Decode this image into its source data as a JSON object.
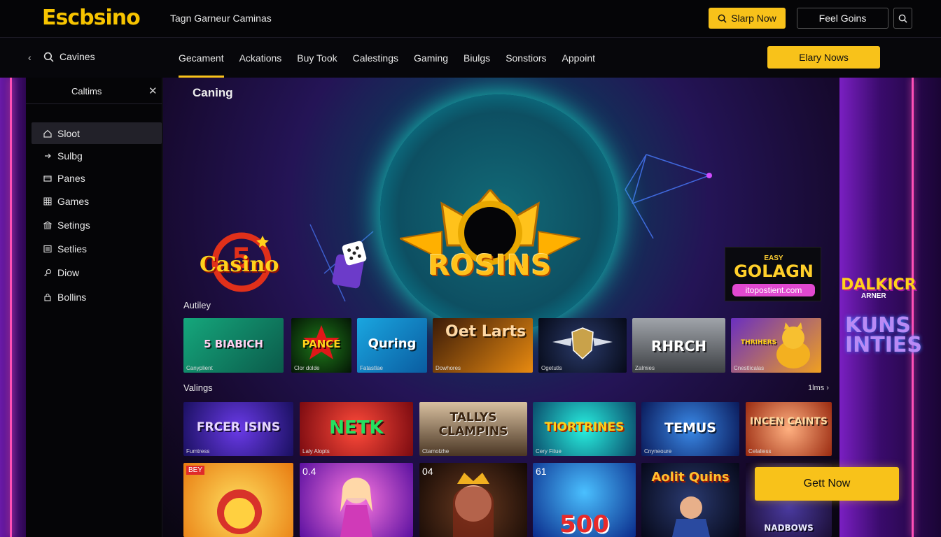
{
  "header": {
    "logo": "Escbsino",
    "tagline": "Tagn Garneur Caminas",
    "signup_label": "Slarp Now",
    "secondary_label": "Feel Goins"
  },
  "nav": {
    "search_label": "Cavines",
    "links": [
      "Gecament",
      "Ackations",
      "Buy Took",
      "Calestings",
      "Gaming",
      "Biulgs",
      "Sonstiors",
      "Appoint"
    ],
    "cta_label": "Elary Nows"
  },
  "sidebar": {
    "title": "Caltims",
    "items": [
      {
        "label": "Sloot",
        "icon": "home-icon"
      },
      {
        "label": "Sulbg",
        "icon": "arrow-icon"
      },
      {
        "label": "Panes",
        "icon": "cards-icon"
      },
      {
        "label": "Games",
        "icon": "grid-icon"
      },
      {
        "label": "Setings",
        "icon": "bank-icon"
      },
      {
        "label": "Setlies",
        "icon": "list-icon"
      },
      {
        "label": "Diow",
        "icon": "key-icon"
      },
      {
        "label": "Bollins",
        "icon": "lock-icon"
      }
    ]
  },
  "hero": {
    "title": "Caning",
    "emblem_text": "ROSINS",
    "casino_text": "Casino",
    "casino_number": "5",
    "promo": {
      "top": "EASY",
      "main": "GOLAGN",
      "bottom": "itopostient.com"
    }
  },
  "sections": {
    "activity_label": "Autiley",
    "valings_label": "Valings",
    "more_label": "1lms ›"
  },
  "row1": [
    {
      "name": "5 BIABICH",
      "cap": "Canyplient",
      "bg": "#15a77c"
    },
    {
      "name": "PANCE",
      "cap": "Clor dolde",
      "bg": "#0a3b12"
    },
    {
      "name": "Quring",
      "cap": "Fatastlae",
      "bg": "#1aa6e0"
    },
    {
      "name": "Oet Larts",
      "cap": "Dowhores",
      "bg": "#3a1a08"
    },
    {
      "name": "",
      "cap": "Ogetutls",
      "bg": "#0c1426"
    },
    {
      "name": "RHRCH",
      "cap": "Zalmies",
      "bg": "#6a6d72"
    },
    {
      "name": "THRIHERS",
      "cap": "Cnestlicalas",
      "bg": "#6a2fc0"
    }
  ],
  "row2": [
    {
      "name": "FRCER ISINS",
      "cap": "Fumtress",
      "bg": "#3a2ad0"
    },
    {
      "name": "NETK",
      "cap": "Laly Alopts",
      "bg": "#e03a3a"
    },
    {
      "name": "TALLYS CLAMPINS",
      "cap": "Ctamolzhe",
      "bg": "#a88a6a"
    },
    {
      "name": "TIORTRINES",
      "cap": "Cery Fitue",
      "bg": "#12c0c4"
    },
    {
      "name": "TEMUS",
      "cap": "Cnyneoure",
      "bg": "#1c3aa0"
    },
    {
      "name": "INCEN CAINTS",
      "cap": "Celaliess",
      "bg": "#e06a4a"
    }
  ],
  "row3": [
    {
      "name": "",
      "badge": "BEY",
      "bg": "#f0c020"
    },
    {
      "name": "",
      "badge": "0.4",
      "bg": "#b23ad0"
    },
    {
      "name": "",
      "badge": "04",
      "bg": "#2a1a12"
    },
    {
      "name": "500",
      "badge": "61",
      "bg": "#1a5ad8"
    },
    {
      "name": "Aolit Quins",
      "badge": "",
      "bg": "#0c1430"
    },
    {
      "name": "NADBOWS",
      "badge": "",
      "bg": "#2a1044"
    }
  ],
  "right_banner": {
    "title": "DALKICR",
    "subtitle": "ARNER",
    "promo": "KUNS INTIES"
  },
  "float_cta": "Gett Now",
  "colors": {
    "accent": "#f8c21a",
    "bg": "#07060c",
    "neon": "#ff4fb6"
  }
}
